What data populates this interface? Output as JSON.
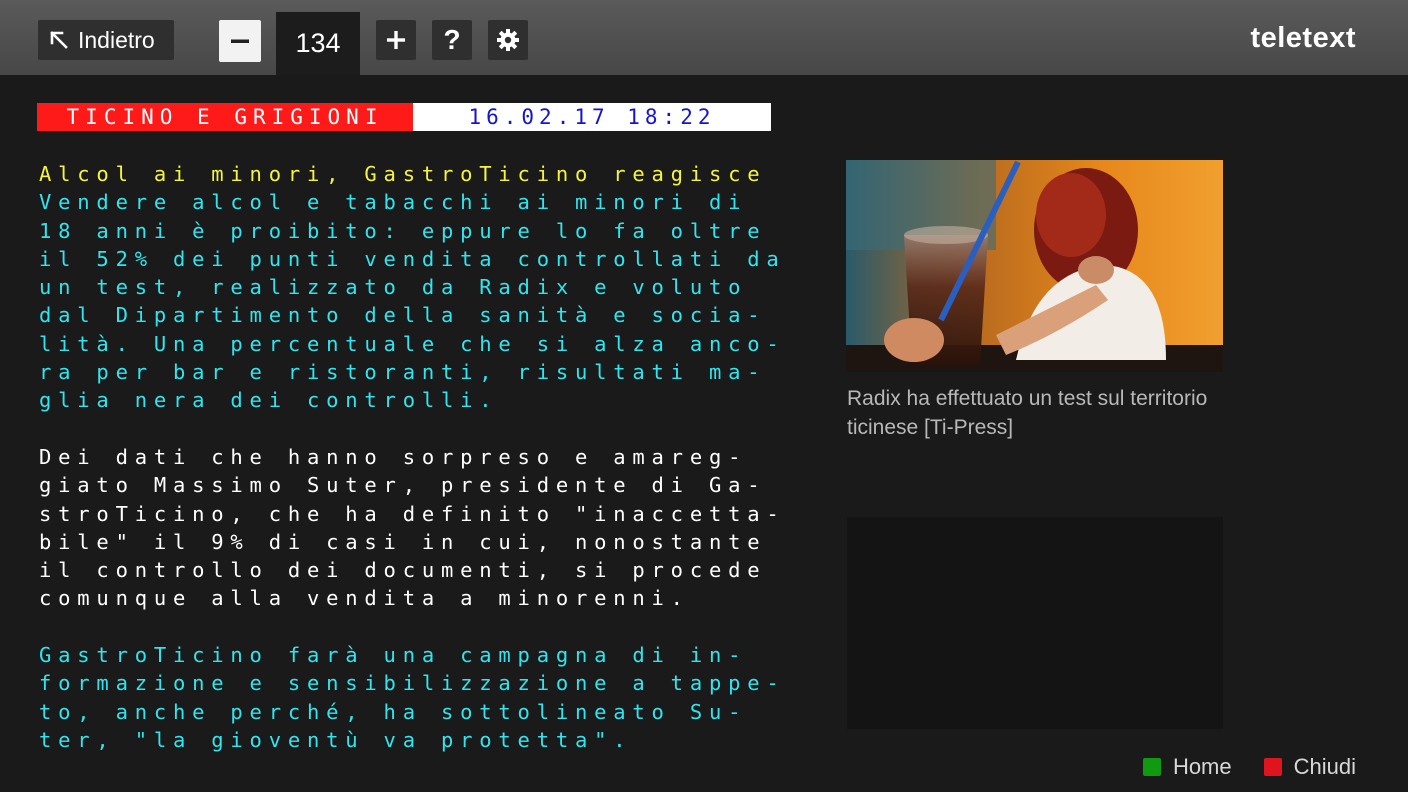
{
  "toolbar": {
    "back_label": "Indietro",
    "page_number": "134",
    "minus_label": "−",
    "plus_label": "+",
    "help_label": "?",
    "logo": "teletext"
  },
  "header": {
    "section": "TICINO E GRIGIONI",
    "datetime": "16.02.17 18:22"
  },
  "article": {
    "lines": [
      {
        "text": "Alcol ai minori, GastroTicino reagisce",
        "color": "yellow"
      },
      {
        "text": "Vendere alcol e tabacchi ai minori di",
        "color": "cyan"
      },
      {
        "text": "18 anni è proibito: eppure lo fa oltre",
        "color": "cyan"
      },
      {
        "text": "il 52% dei punti vendita controllati da",
        "color": "cyan"
      },
      {
        "text": "un test, realizzato da Radix e voluto",
        "color": "cyan"
      },
      {
        "text": "dal Dipartimento della sanità e socia-",
        "color": "cyan"
      },
      {
        "text": "lità. Una percentuale che si alza anco-",
        "color": "cyan"
      },
      {
        "text": "ra per bar e ristoranti, risultati ma-",
        "color": "cyan"
      },
      {
        "text": "glia nera dei controlli.",
        "color": "cyan"
      },
      {
        "text": "",
        "color": "white"
      },
      {
        "text": "Dei dati che hanno sorpreso e amareg-",
        "color": "white"
      },
      {
        "text": "giato Massimo Suter, presidente di Ga-",
        "color": "white"
      },
      {
        "text": "stroTicino, che ha definito \"inaccetta-",
        "color": "white"
      },
      {
        "text": "bile\" il 9% di casi in cui, nonostante",
        "color": "white"
      },
      {
        "text": "il controllo dei documenti, si procede",
        "color": "white"
      },
      {
        "text": "comunque alla vendita a minorenni.",
        "color": "white"
      },
      {
        "text": "",
        "color": "white"
      },
      {
        "text": "GastroTicino farà una campagna di in-",
        "color": "cyan"
      },
      {
        "text": "formazione e sensibilizzazione a tappe-",
        "color": "cyan"
      },
      {
        "text": "to, anche perché, ha sottolineato Su-",
        "color": "cyan"
      },
      {
        "text": "ter, \"la gioventù va protetta\".",
        "color": "cyan"
      }
    ]
  },
  "image": {
    "caption": "Radix ha effettuato un test sul territorio ticinese [Ti-Press]"
  },
  "footer": {
    "home_label": "Home",
    "close_label": "Chiudi"
  },
  "colors": {
    "yellow": "#f5f53c",
    "cyan": "#2ee6f0",
    "white": "#ffffff",
    "header_red": "#ff1a1a",
    "date_blue": "#1515d0",
    "home_green": "#0f9a0f",
    "close_red": "#e0141e"
  }
}
